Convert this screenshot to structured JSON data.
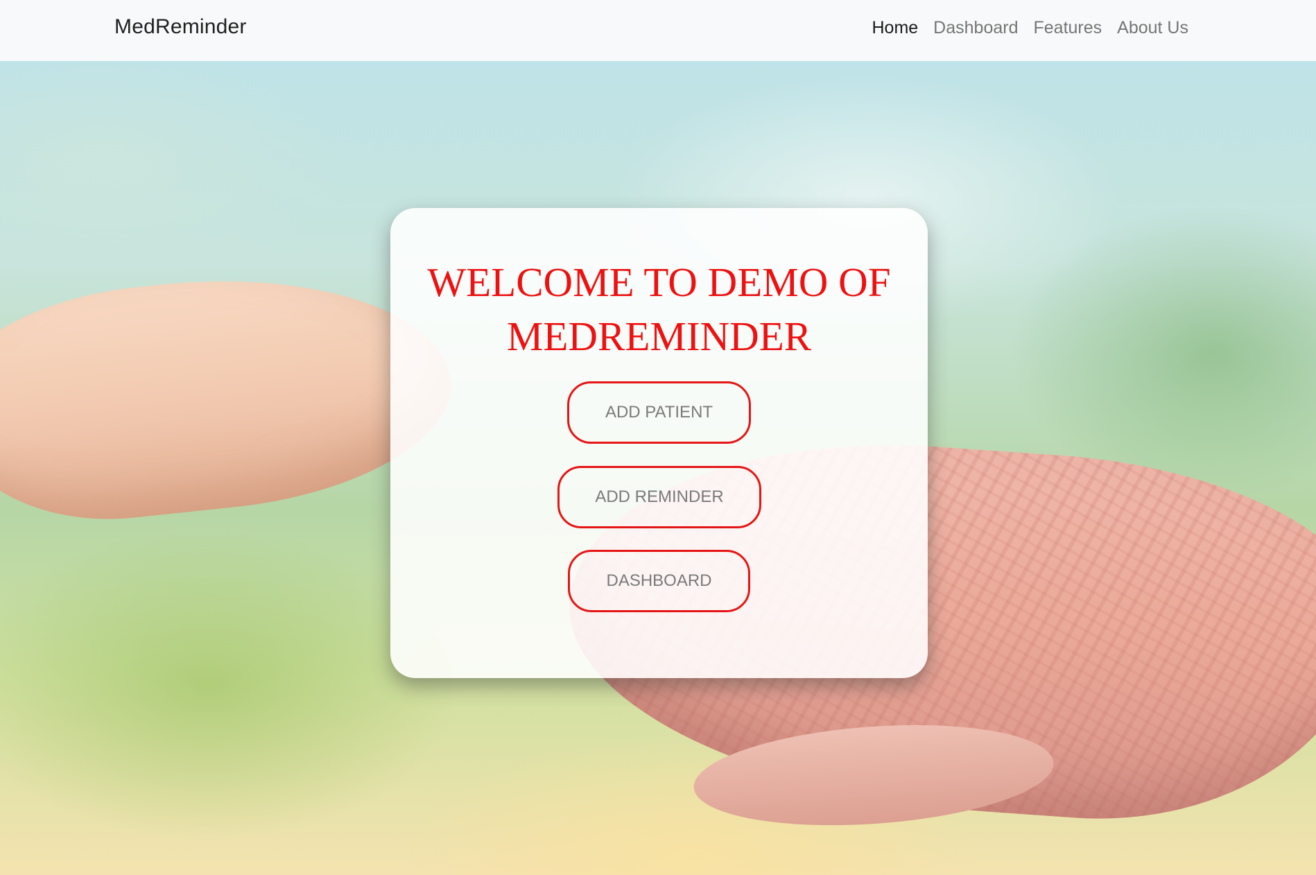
{
  "navbar": {
    "brand": "MedReminder",
    "links": [
      {
        "label": "Home",
        "active": true
      },
      {
        "label": "Dashboard",
        "active": false
      },
      {
        "label": "Features",
        "active": false
      },
      {
        "label": "About Us",
        "active": false
      }
    ]
  },
  "card": {
    "title": "WELCOME TO DEMO OF MEDREMINDER",
    "buttons": {
      "add_patient": "ADD PATIENT",
      "add_reminder": "ADD REMINDER",
      "dashboard": "DASHBOARD"
    }
  },
  "colors": {
    "accent": "#ee1111",
    "navbar_bg": "#f8f9fa",
    "button_text": "#7a7a7a"
  }
}
